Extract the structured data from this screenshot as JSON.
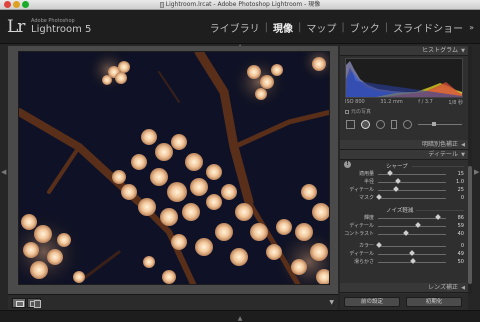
{
  "window": {
    "title": "Lightroom.lrcat - Adobe Photoshop Lightroom - 現像"
  },
  "identity": {
    "logo": "Lr",
    "brand": "Adobe Photoshop",
    "product": "Lightroom 5"
  },
  "modules": {
    "items": [
      "ライブラリ",
      "現像",
      "マップ",
      "ブック",
      "スライドショー"
    ],
    "active": "現像",
    "more_arrow": "»"
  },
  "histogram": {
    "title": "ヒストグラム",
    "iso": "ISO 800",
    "focal": "31.2 mm",
    "aperture": "f / 3.7",
    "shutter": "1/8 秒",
    "original_photo_label": "元の写真"
  },
  "panels": {
    "basic_collapsed": "明暗別色補正",
    "detail": "ディテール",
    "lens": "レンズ補正"
  },
  "sharpening": {
    "title": "シャープ",
    "rows": [
      {
        "label": "適用量",
        "value": "15"
      },
      {
        "label": "半径",
        "value": "1.0"
      },
      {
        "label": "ディテール",
        "value": "25"
      },
      {
        "label": "マスク",
        "value": "0"
      }
    ]
  },
  "noise": {
    "title": "ノイズ軽減",
    "rows": [
      {
        "label": "輝度",
        "value": "86"
      },
      {
        "label": "ディテール",
        "value": "59"
      },
      {
        "label": "コントラスト",
        "value": "40"
      },
      {
        "label": "カラー",
        "value": "0"
      },
      {
        "label": "ディテール",
        "value": "49"
      },
      {
        "label": "滑らかさ",
        "value": "50"
      }
    ]
  },
  "buttons": {
    "previous": "前の設定",
    "reset": "初期化"
  },
  "toolbar": {
    "menu_arrow": "▼"
  },
  "icons": {
    "panel_collapse": "triangle-icon",
    "info": "info-icon"
  }
}
